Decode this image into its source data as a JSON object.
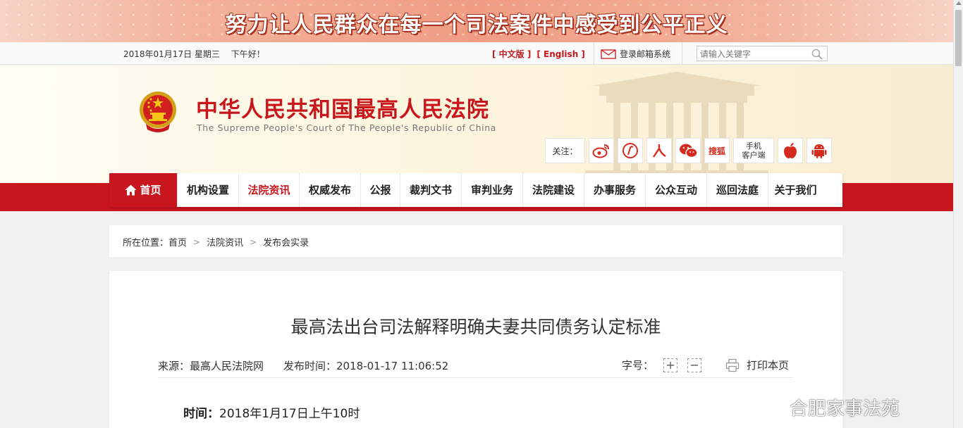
{
  "banner": {
    "slogan": "努力让人民群众在每一个司法案件中感受到公平正义"
  },
  "topbar": {
    "date": "2018年01月17日 星期三",
    "greeting": "下午好！",
    "lang_cn": "[ 中文版 ]",
    "lang_en": "[ English ]",
    "mail_label": "登录邮箱系统",
    "search_placeholder": "请输入关键字"
  },
  "header": {
    "court_name": "中华人民共和国最高人民法院",
    "court_name_en": "The Supreme People's Court of The People's Republic of China",
    "follow_label": "关注：",
    "sohu_label": "搜狐",
    "mobile_line1": "手机",
    "mobile_line2": "客户端",
    "icons": [
      "weibo-icon",
      "weixin-mp-icon",
      "renmin-icon",
      "wechat-icon",
      "sohu-icon",
      "apple-icon",
      "android-icon"
    ]
  },
  "nav": {
    "items": [
      "首页",
      "机构设置",
      "法院资讯",
      "权威发布",
      "公报",
      "裁判文书",
      "审判业务",
      "法院建设",
      "办事服务",
      "公众互动",
      "巡回法庭",
      "关于我们"
    ],
    "active": "法院资讯"
  },
  "breadcrumb": {
    "prefix": "所在位置：",
    "items": [
      "首页",
      "法院资讯",
      "发布会实录"
    ]
  },
  "article": {
    "title": "最高法出台司法解释明确夫妻共同债务认定标准",
    "source": "来源：最高人民法院网",
    "publish_time": "发布时间：2018-01-17 11:06:52",
    "fontsize_label": "字号：",
    "fontsize_plus": "+",
    "fontsize_minus": "−",
    "print_label": "打印本页",
    "time_label": "时间：",
    "time_value": "2018年1月17日上午10时"
  },
  "watermark": {
    "text": "合肥家事法苑"
  },
  "colors": {
    "brand_red": "#c7161e",
    "banner": "#ef9c82",
    "header_bg": "#fdf6e0"
  }
}
